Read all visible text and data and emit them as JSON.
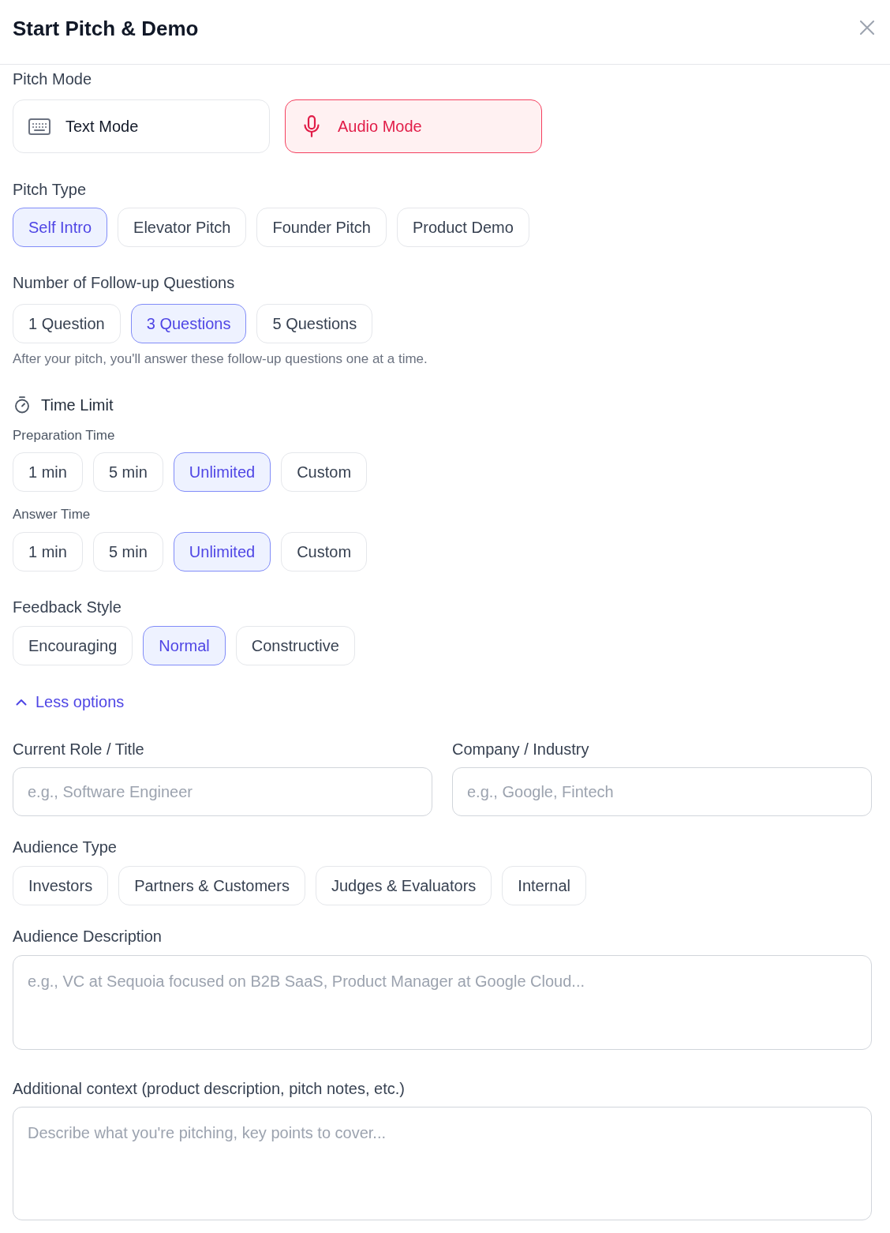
{
  "dialog": {
    "title": "Start Pitch & Demo"
  },
  "pitch_mode": {
    "label": "Pitch Mode",
    "options": [
      {
        "kind": "text",
        "label": "Text Mode",
        "selected": false
      },
      {
        "kind": "audio",
        "label": "Audio Mode",
        "selected": true
      }
    ]
  },
  "pitch_type": {
    "label": "Pitch Type",
    "options": [
      {
        "label": "Self Intro",
        "selected": true
      },
      {
        "label": "Elevator Pitch",
        "selected": false
      },
      {
        "label": "Founder Pitch",
        "selected": false
      },
      {
        "label": "Product Demo",
        "selected": false
      }
    ]
  },
  "follow_up_questions": {
    "label": "Number of Follow-up Questions",
    "options": [
      {
        "label": "1 Question",
        "selected": false
      },
      {
        "label": "3 Questions",
        "selected": true
      },
      {
        "label": "5 Questions",
        "selected": false
      }
    ],
    "hint": "After your pitch, you'll answer these follow-up questions one at a time."
  },
  "time_limit": {
    "label": "Time Limit",
    "preparation_time": {
      "label": "Preparation Time",
      "options": [
        {
          "label": "1 min",
          "selected": false
        },
        {
          "label": "5 min",
          "selected": false
        },
        {
          "label": "Unlimited",
          "selected": true
        },
        {
          "label": "Custom",
          "selected": false
        }
      ]
    },
    "answer_time": {
      "label": "Answer Time",
      "options": [
        {
          "label": "1 min",
          "selected": false
        },
        {
          "label": "5 min",
          "selected": false
        },
        {
          "label": "Unlimited",
          "selected": true
        },
        {
          "label": "Custom",
          "selected": false
        }
      ]
    }
  },
  "feedback_style": {
    "label": "Feedback Style",
    "options": [
      {
        "label": "Encouraging",
        "selected": false
      },
      {
        "label": "Normal",
        "selected": true
      },
      {
        "label": "Constructive",
        "selected": false
      }
    ]
  },
  "options_toggle": {
    "label": "Less options",
    "expanded": true
  },
  "profile_fields": [
    {
      "label": "Current Role / Title",
      "placeholder": "e.g., Software Engineer"
    },
    {
      "label": "Company / Industry",
      "placeholder": "e.g., Google, Fintech"
    }
  ],
  "audience_type": {
    "label": "Audience Type",
    "options": [
      {
        "label": "Investors",
        "selected": false
      },
      {
        "label": "Partners & Customers",
        "selected": false
      },
      {
        "label": "Judges & Evaluators",
        "selected": false
      },
      {
        "label": "Internal",
        "selected": false
      }
    ]
  },
  "audience_description": {
    "label": "Audience Description",
    "placeholder": "e.g., VC at Sequoia focused on B2B SaaS, Product Manager at Google Cloud..."
  },
  "additional_context": {
    "label": "Additional context (product description, pitch notes, etc.)",
    "placeholder": "Describe what you're pitching, key points to cover..."
  }
}
